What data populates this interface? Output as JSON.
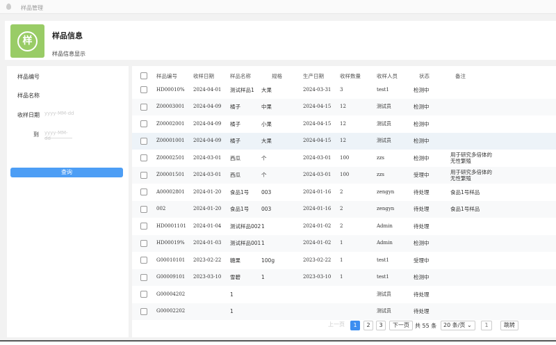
{
  "topbar": {
    "title": "样品管理",
    "icon": "location-pin-icon"
  },
  "header": {
    "logo_char": "样",
    "title": "样品信息",
    "subtitle": "样品信息显示"
  },
  "filters": {
    "sample_no_label": "样品编号",
    "sample_name_label": "样品名称",
    "receive_date_label": "收样日期",
    "receive_date_from": "yyyy-MM-dd",
    "to_label": "到",
    "receive_date_to": "yyyy-MM-dd",
    "query_button": "查询"
  },
  "table": {
    "columns": [
      "样品编号",
      "收样日期",
      "样品名称",
      "规格",
      "生产日期",
      "收样数量",
      "收样人员",
      "状态",
      "备注"
    ],
    "rows": [
      [
        "HD00010%",
        "2024-04-01",
        "测试样品1",
        "大果",
        "2024-03-31",
        "3",
        "test1",
        "检测中",
        ""
      ],
      [
        "Z00003001",
        "2024-04-09",
        "橘子",
        "中果",
        "2024-04-15",
        "12",
        "测试员",
        "检测中",
        ""
      ],
      [
        "Z00002001",
        "2024-04-09",
        "橘子",
        "小果",
        "2024-04-15",
        "12",
        "测试员",
        "检测中",
        ""
      ],
      [
        "Z00001001",
        "2024-04-09",
        "橘子",
        "大果",
        "2024-04-15",
        "12",
        "测试员",
        "检测中",
        ""
      ],
      [
        "Z00002501",
        "2024-03-01",
        "西瓜",
        "个",
        "2024-03-01",
        "100",
        "zzs",
        "检测中",
        "用于研究多倍体的无性繁殖"
      ],
      [
        "Z00001501",
        "2024-03-01",
        "西瓜",
        "个",
        "2024-03-01",
        "100",
        "zzs",
        "受理中",
        "用于研究多倍体的无性繁殖"
      ],
      [
        "A00002801",
        "2024-01-20",
        "食品1号",
        "003",
        "2024-01-16",
        "2",
        "zengyn",
        "待处理",
        "食品1号样品"
      ],
      [
        "002",
        "2024-01-20",
        "食品1号",
        "003",
        "2024-01-16",
        "2",
        "zengyn",
        "待处理",
        "食品1号样品"
      ],
      [
        "HD0001101",
        "2024-01-04",
        "测试样品002",
        "1",
        "2024-01-02",
        "2",
        "Admin",
        "待处理",
        ""
      ],
      [
        "HD00019%",
        "2024-01-03",
        "测试样品001",
        "1",
        "2024-01-02",
        "1",
        "Admin",
        "检测中",
        ""
      ],
      [
        "G00010101",
        "2023-02-22",
        "糖果",
        "100g",
        "2023-02-22",
        "1",
        "test1",
        "受理中",
        ""
      ],
      [
        "G00009101",
        "2023-03-10",
        "雪碧",
        "1",
        "2023-03-10",
        "1",
        "test1",
        "检测中",
        ""
      ],
      [
        "G00004202",
        "",
        "1",
        "",
        "",
        "",
        "测试员",
        "待处理",
        ""
      ],
      [
        "G00002202",
        "",
        "1",
        "",
        "",
        "",
        "测试员",
        "待处理",
        ""
      ]
    ]
  },
  "pagination": {
    "prev": "上一页",
    "pages": [
      "1",
      "2",
      "3"
    ],
    "current": "1",
    "next": "下一页",
    "total": "共 55 条",
    "page_size": "20 条/页",
    "jump_value": "1",
    "jump_button": "跳转"
  }
}
